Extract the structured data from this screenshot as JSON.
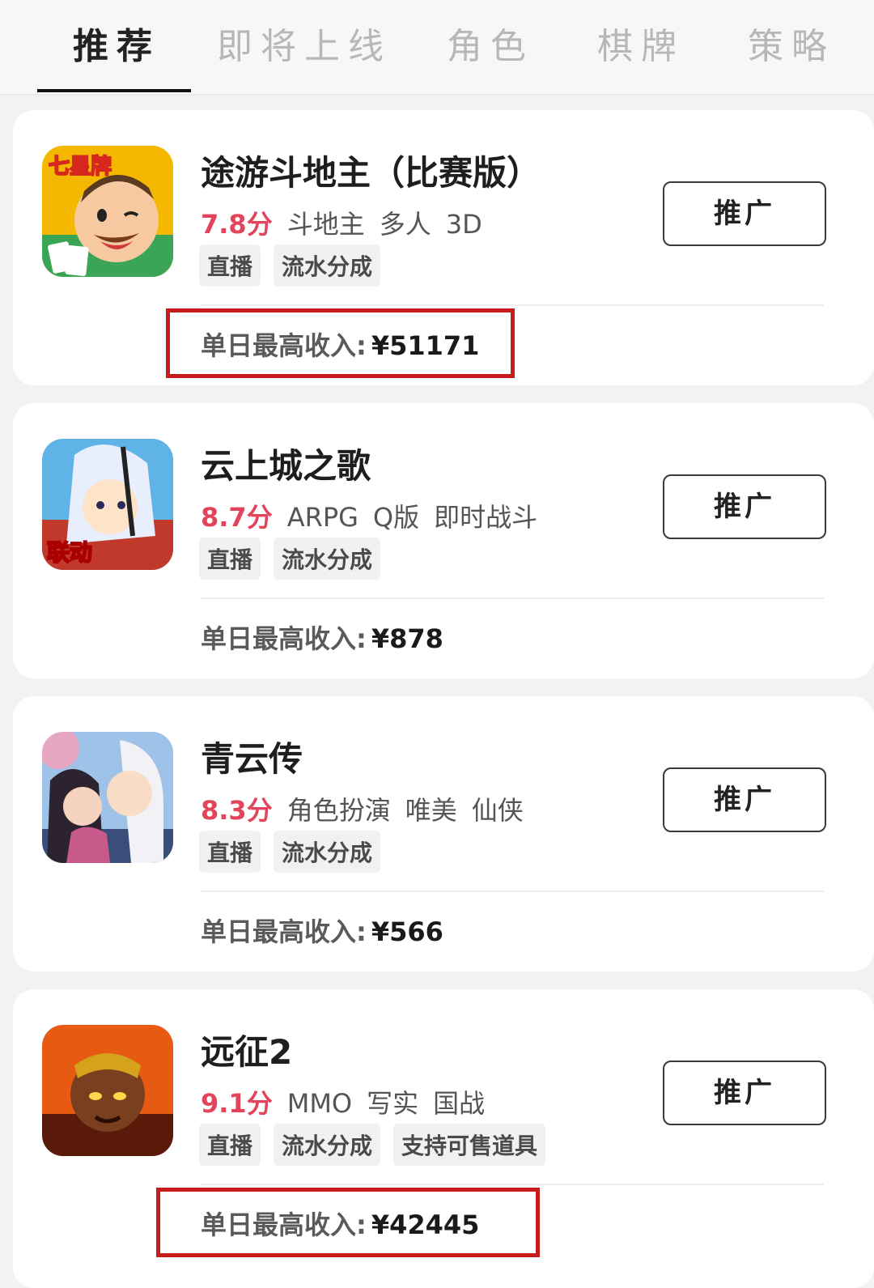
{
  "tabs": [
    {
      "label": "推荐"
    },
    {
      "label": "即将上线"
    },
    {
      "label": "角色"
    },
    {
      "label": "棋牌"
    },
    {
      "label": "策略"
    }
  ],
  "active_tab": "推荐",
  "games": [
    {
      "title": "途游斗地主（比赛版）",
      "score": "7.8分",
      "genres": [
        "斗地主",
        "多人",
        "3D"
      ],
      "tags": [
        "直播",
        "流水分成"
      ],
      "button": "推广",
      "income_label": "单日最高收入:",
      "income_value": "¥51171",
      "icon_badge": "七星牌",
      "highlighted": true
    },
    {
      "title": "云上城之歌",
      "score": "8.7分",
      "genres": [
        "ARPG",
        "Q版",
        "即时战斗"
      ],
      "tags": [
        "直播",
        "流水分成"
      ],
      "button": "推广",
      "income_label": "单日最高收入:",
      "income_value": "¥878",
      "icon_badge": "联动",
      "highlighted": false
    },
    {
      "title": "青云传",
      "score": "8.3分",
      "genres": [
        "角色扮演",
        "唯美",
        "仙侠"
      ],
      "tags": [
        "直播",
        "流水分成"
      ],
      "button": "推广",
      "income_label": "单日最高收入:",
      "income_value": "¥566",
      "highlighted": false
    },
    {
      "title": "远征2",
      "score": "9.1分",
      "genres": [
        "MMO",
        "写实",
        "国战"
      ],
      "tags": [
        "直播",
        "流水分成",
        "支持可售道具"
      ],
      "button": "推广",
      "income_label": "单日最高收入:",
      "income_value": "¥42445",
      "highlighted": true
    }
  ],
  "colors": {
    "score": "#e2445c",
    "highlight_box": "#c81b1b",
    "background": "#f2f2f2"
  }
}
